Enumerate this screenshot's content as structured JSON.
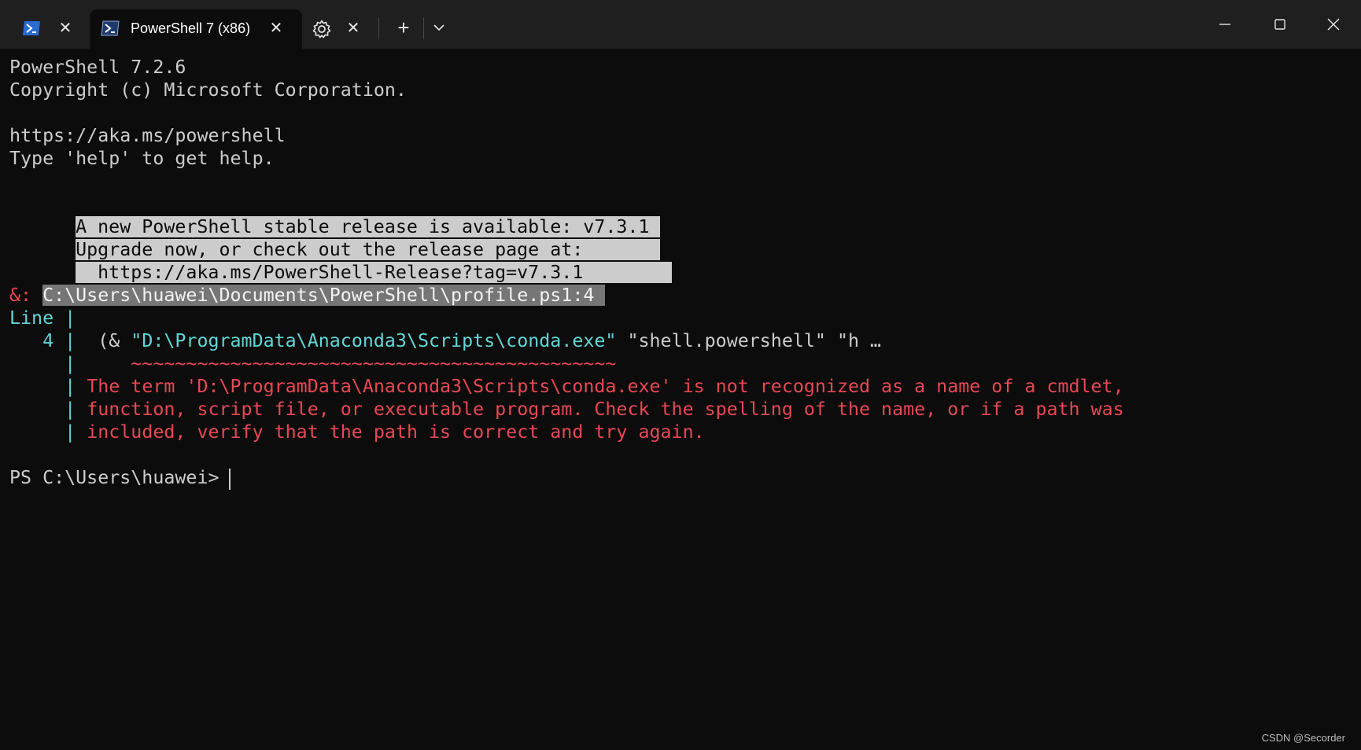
{
  "tabs": [
    {
      "icon": "powershell-icon",
      "title": ""
    },
    {
      "icon": "powershell-icon",
      "title": "PowerShell 7 (x86)"
    },
    {
      "icon": "gear-icon",
      "title": ""
    }
  ],
  "window_controls": {
    "minimize_icon": "minimize-icon",
    "maximize_icon": "maximize-icon",
    "close_icon": "close-icon"
  },
  "terminal": {
    "line1": "PowerShell 7.2.6",
    "line2": "Copyright (c) Microsoft Corporation.",
    "line3": "https://aka.ms/powershell",
    "line4": "Type 'help' to get help.",
    "update_notice": [
      "A new PowerShell stable release is available: v7.3.1 ",
      "Upgrade now, or check out the release page at:       ",
      "  https://aka.ms/PowerShell-Release?tag=v7.3.1        "
    ],
    "error_prefix": "&: ",
    "error_path": "C:\\Users\\huawei\\Documents\\PowerShell\\profile.ps1:4 ",
    "line_label": "Line |",
    "line_number": "   4 |",
    "code_prefix": "  (& ",
    "code_string": "\"D:\\ProgramData\\Anaconda3\\Scripts\\conda.exe\"",
    "code_suffix": " \"shell.powershell\" \"h …",
    "squiggle_bar": "     |",
    "squiggle": "     ~~~~~~~~~~~~~~~~~~~~~~~~~~~~~~~~~~~~~~~~~~~~",
    "error_bar": "     | ",
    "error_lines": [
      "The term 'D:\\ProgramData\\Anaconda3\\Scripts\\conda.exe' is not recognized as a name of a cmdlet,",
      "function, script file, or executable program. Check the spelling of the name, or if a path was",
      "included, verify that the path is correct and try again."
    ],
    "prompt": "PS C:\\Users\\huawei> "
  },
  "watermark": "CSDN @Secorder",
  "colors": {
    "background": "#0c0c0c",
    "foreground": "#cccccc",
    "error": "#e74856",
    "accent": "#61d6d6"
  }
}
